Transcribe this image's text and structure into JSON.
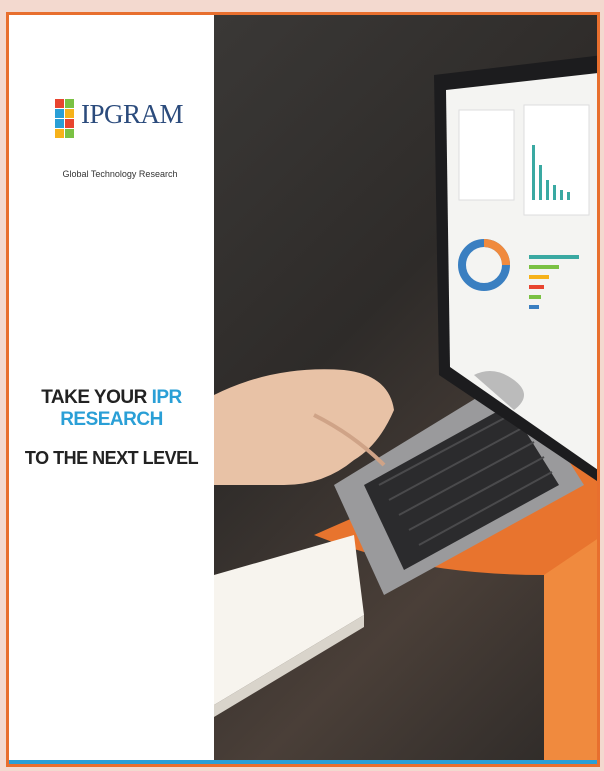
{
  "brand": {
    "logo_text": "IPGRAM",
    "tagline": "Global Technology Research",
    "logo_colors": [
      "#e8452f",
      "#2a9fd6",
      "#7ac143",
      "#f6b21a"
    ]
  },
  "headline": {
    "line1_prefix": "TAKE YOUR ",
    "line1_highlight": "IPR RESEARCH",
    "line2": "TO THE NEXT LEVEL"
  },
  "colors": {
    "accent": "#2a9fd6",
    "border": "#e86f2e",
    "text_dark": "#222222"
  },
  "photo": {
    "description_icon": "laptop-analytics-photo"
  }
}
